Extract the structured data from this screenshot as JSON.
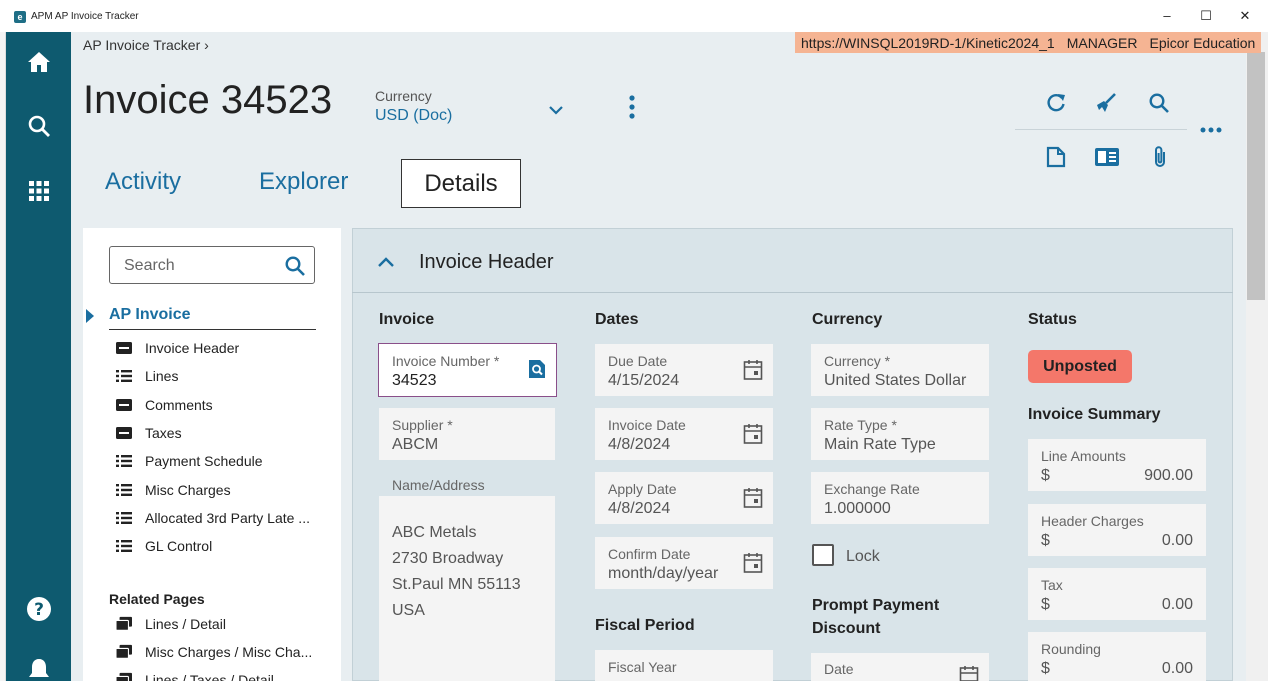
{
  "window": {
    "badge": "e",
    "title": "APM AP Invoice Tracker",
    "minimize": "–",
    "maximize": "☐",
    "close": "✕"
  },
  "rail": {
    "items": [
      "home-icon",
      "search-icon",
      "apps-grid-icon",
      "help-icon",
      "bell-icon"
    ]
  },
  "breadcrumb": "AP Invoice Tracker  ›",
  "environment": {
    "url": "https://WINSQL2019RD-1/Kinetic2024_1",
    "user": "MANAGER",
    "company": "Epicor Education"
  },
  "header": {
    "title": "Invoice 34523",
    "currency_label": "Currency",
    "currency_value": "USD (Doc)"
  },
  "toolbar": {
    "icons": [
      "refresh-icon",
      "clear-broom-icon",
      "search-icon",
      "new-document-icon",
      "reader-view-icon",
      "attachment-icon",
      "overflow-menu-icon"
    ]
  },
  "tabs": [
    {
      "label": "Activity"
    },
    {
      "label": "Explorer"
    },
    {
      "label": "Details",
      "active": true
    }
  ],
  "sidenav": {
    "search_placeholder": "Search",
    "heading": "AP Invoice",
    "items": [
      {
        "label": "Invoice Header",
        "icon": "card-icon"
      },
      {
        "label": "Lines",
        "icon": "list-icon"
      },
      {
        "label": "Comments",
        "icon": "card-icon"
      },
      {
        "label": "Taxes",
        "icon": "card-icon"
      },
      {
        "label": "Payment Schedule",
        "icon": "list-icon"
      },
      {
        "label": "Misc Charges",
        "icon": "list-icon"
      },
      {
        "label": "Allocated 3rd Party Late ...",
        "icon": "list-icon"
      },
      {
        "label": "GL Control",
        "icon": "list-icon"
      }
    ],
    "related_heading": "Related Pages",
    "related": [
      {
        "label": "Lines / Detail"
      },
      {
        "label": "Misc Charges / Misc Cha..."
      },
      {
        "label": "Lines / Taxes / Detail"
      }
    ]
  },
  "panel": {
    "title": "Invoice Header",
    "columns": {
      "invoice": "Invoice",
      "dates": "Dates",
      "currency": "Currency",
      "status": "Status"
    },
    "invoice": {
      "number_label": "Invoice Number *",
      "number_value": "34523",
      "supplier_label": "Supplier *",
      "supplier_value": "ABCM",
      "address_label": "Name/Address",
      "address_lines": [
        "ABC Metals",
        "2730 Broadway",
        "St.Paul MN 55113",
        "USA"
      ]
    },
    "dates": {
      "due_label": "Due Date",
      "due_value": "4/15/2024",
      "invoice_label": "Invoice Date",
      "invoice_value": "4/8/2024",
      "apply_label": "Apply Date",
      "apply_value": "4/8/2024",
      "confirm_label": "Confirm Date",
      "confirm_value": "month/day/year",
      "fiscal_heading": "Fiscal Period",
      "fiscal_year_label": "Fiscal Year"
    },
    "currency": {
      "currency_label": "Currency *",
      "currency_value": "United States Dollar",
      "rate_type_label": "Rate Type *",
      "rate_type_value": "Main Rate Type",
      "exchange_label": "Exchange Rate",
      "exchange_value": "1.000000",
      "lock_label": "Lock",
      "prompt_heading_1": "Prompt Payment",
      "prompt_heading_2": "Discount",
      "date_label": "Date"
    },
    "status": {
      "badge": "Unposted",
      "badge_color": "#f4776a",
      "summary_heading": "Invoice Summary",
      "rows": [
        {
          "label": "Line Amounts",
          "symbol": "$",
          "value": "900.00"
        },
        {
          "label": "Header Charges",
          "symbol": "$",
          "value": "0.00"
        },
        {
          "label": "Tax",
          "symbol": "$",
          "value": "0.00"
        },
        {
          "label": "Rounding",
          "symbol": "$",
          "value": "0.00"
        }
      ]
    }
  },
  "colors": {
    "rail": "#0e5a6f",
    "accent": "#1a6ea0",
    "env_banner": "#f5b493"
  }
}
